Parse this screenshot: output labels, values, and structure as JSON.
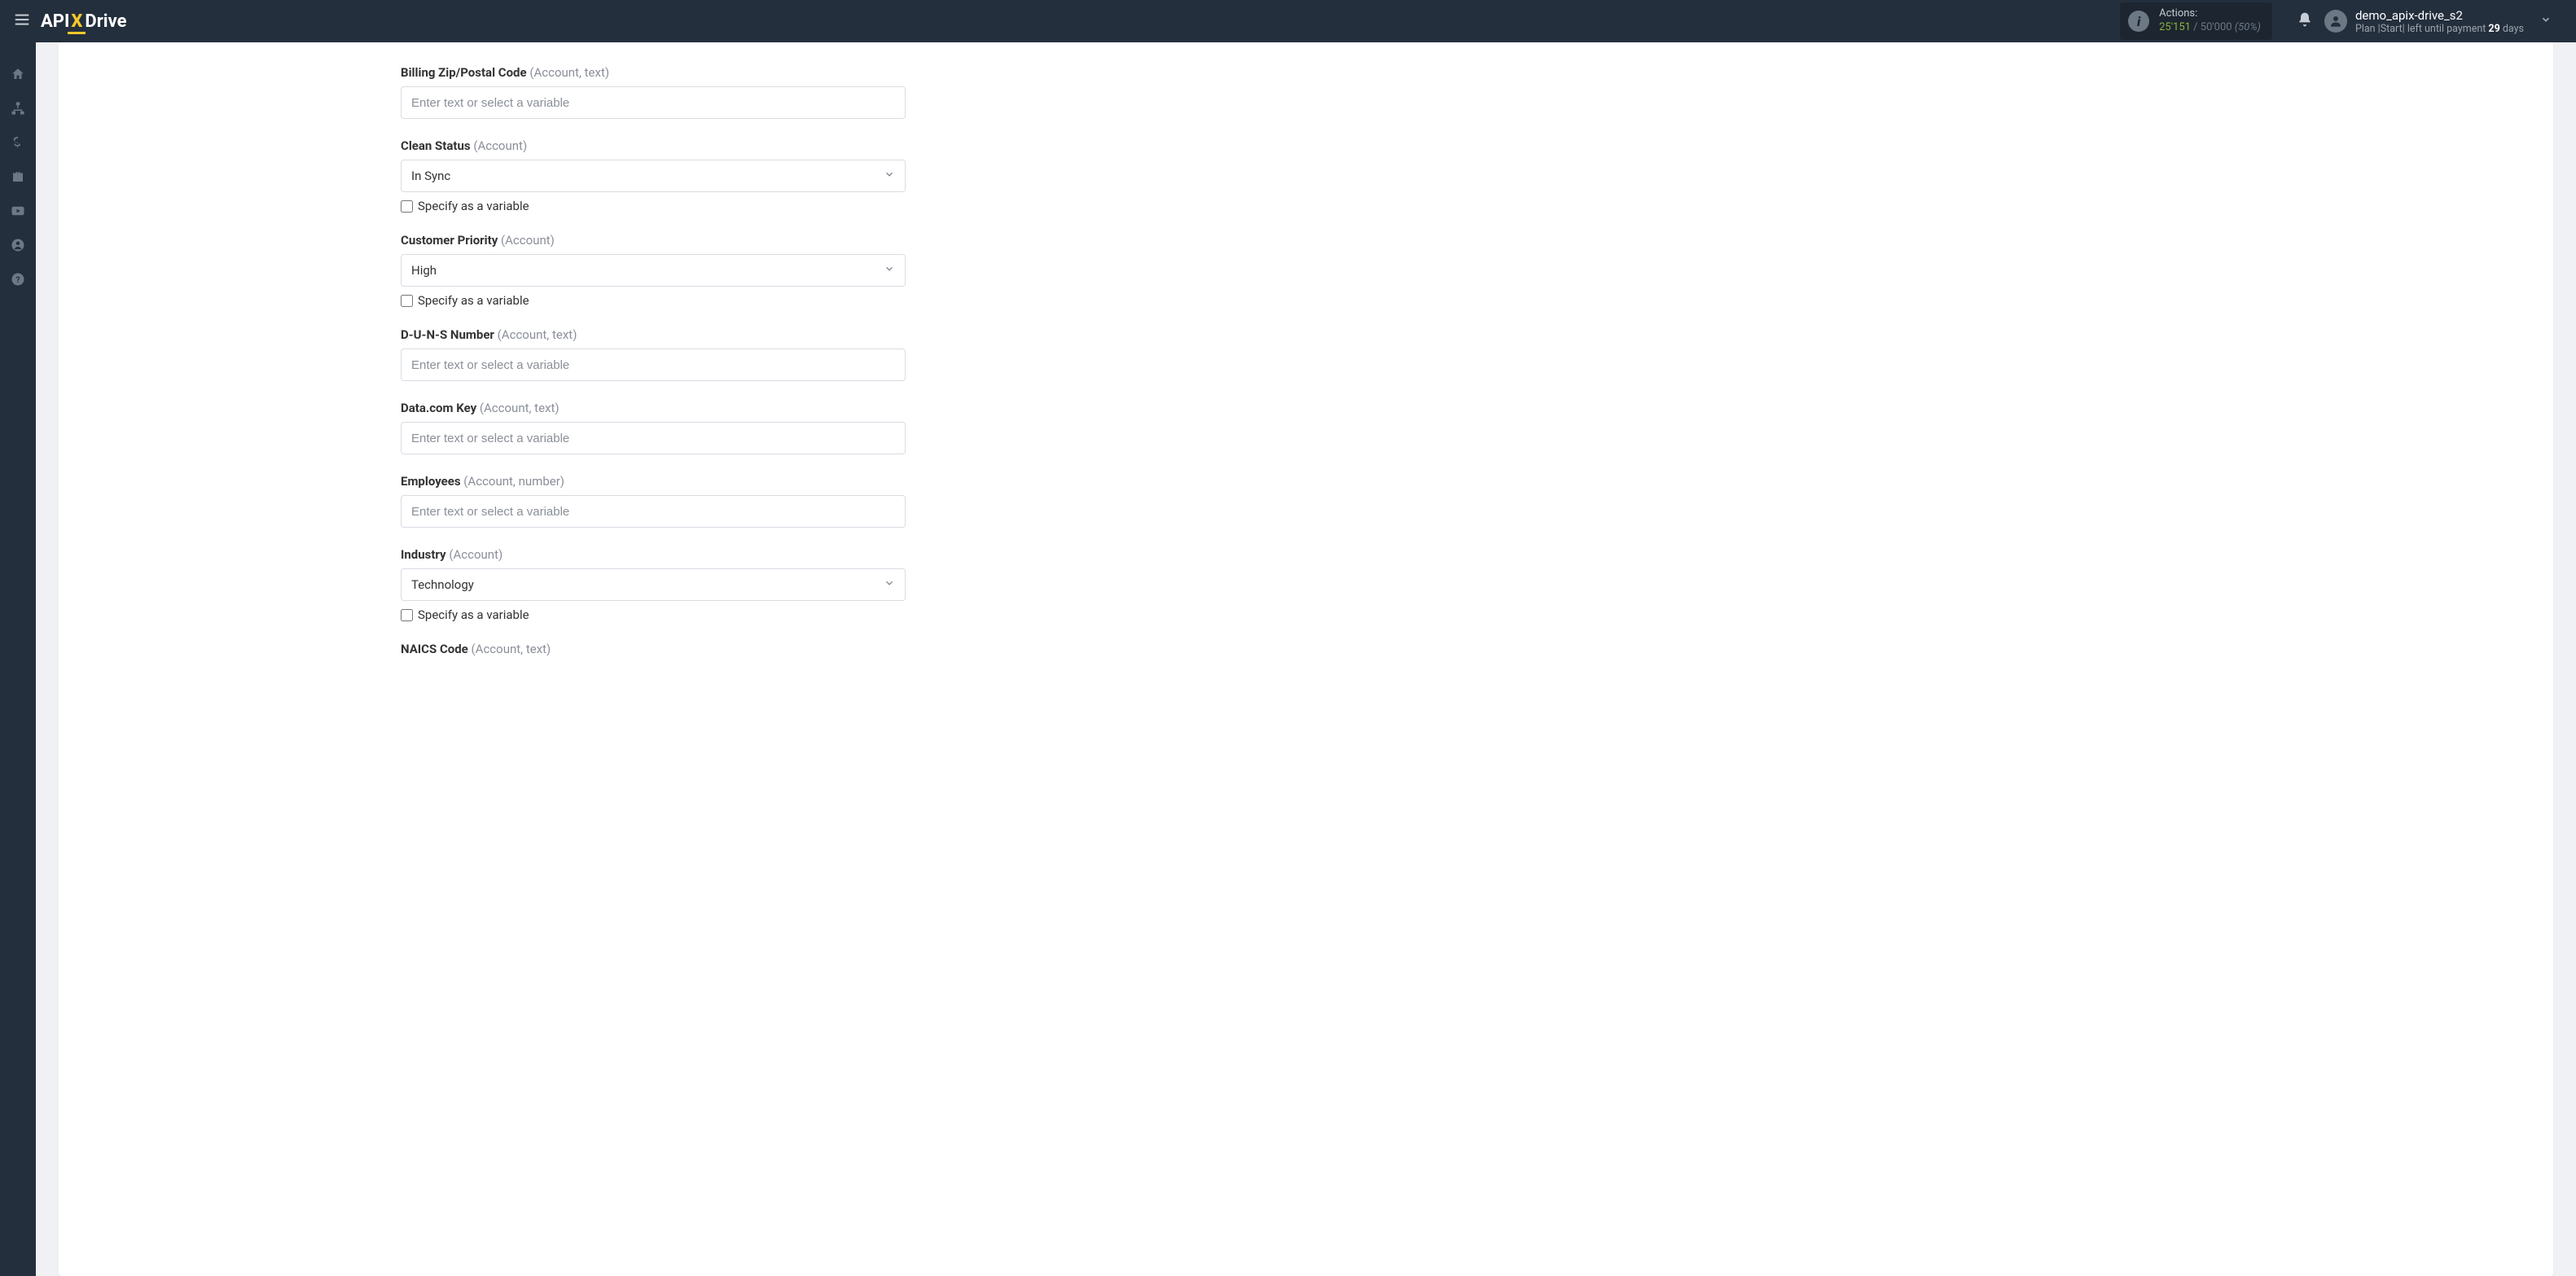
{
  "brand": {
    "part1": "API",
    "part2": "X",
    "part3": "Drive"
  },
  "actions": {
    "label": "Actions:",
    "used": "25'151",
    "separator": "/",
    "total": "50'000",
    "percent": "(50%)"
  },
  "user": {
    "name": "demo_apix-drive_s2",
    "plan_prefix": "Plan |Start| left until payment ",
    "plan_days": "29",
    "plan_suffix": " days"
  },
  "form": {
    "placeholder_text": "Enter text or select a variable",
    "specify_label": "Specify as a variable",
    "fields": [
      {
        "name": "Billing Zip/Postal Code",
        "hint": "(Account, text)",
        "type": "text"
      },
      {
        "name": "Clean Status",
        "hint": "(Account)",
        "type": "select",
        "value": "In Sync"
      },
      {
        "name": "Customer Priority",
        "hint": "(Account)",
        "type": "select",
        "value": "High"
      },
      {
        "name": "D-U-N-S Number",
        "hint": "(Account, text)",
        "type": "text"
      },
      {
        "name": "Data.com Key",
        "hint": "(Account, text)",
        "type": "text"
      },
      {
        "name": "Employees",
        "hint": "(Account, number)",
        "type": "text"
      },
      {
        "name": "Industry",
        "hint": "(Account)",
        "type": "select",
        "value": "Technology"
      }
    ],
    "partial": {
      "name": "NAICS Code",
      "hint": "(Account, text)"
    }
  }
}
